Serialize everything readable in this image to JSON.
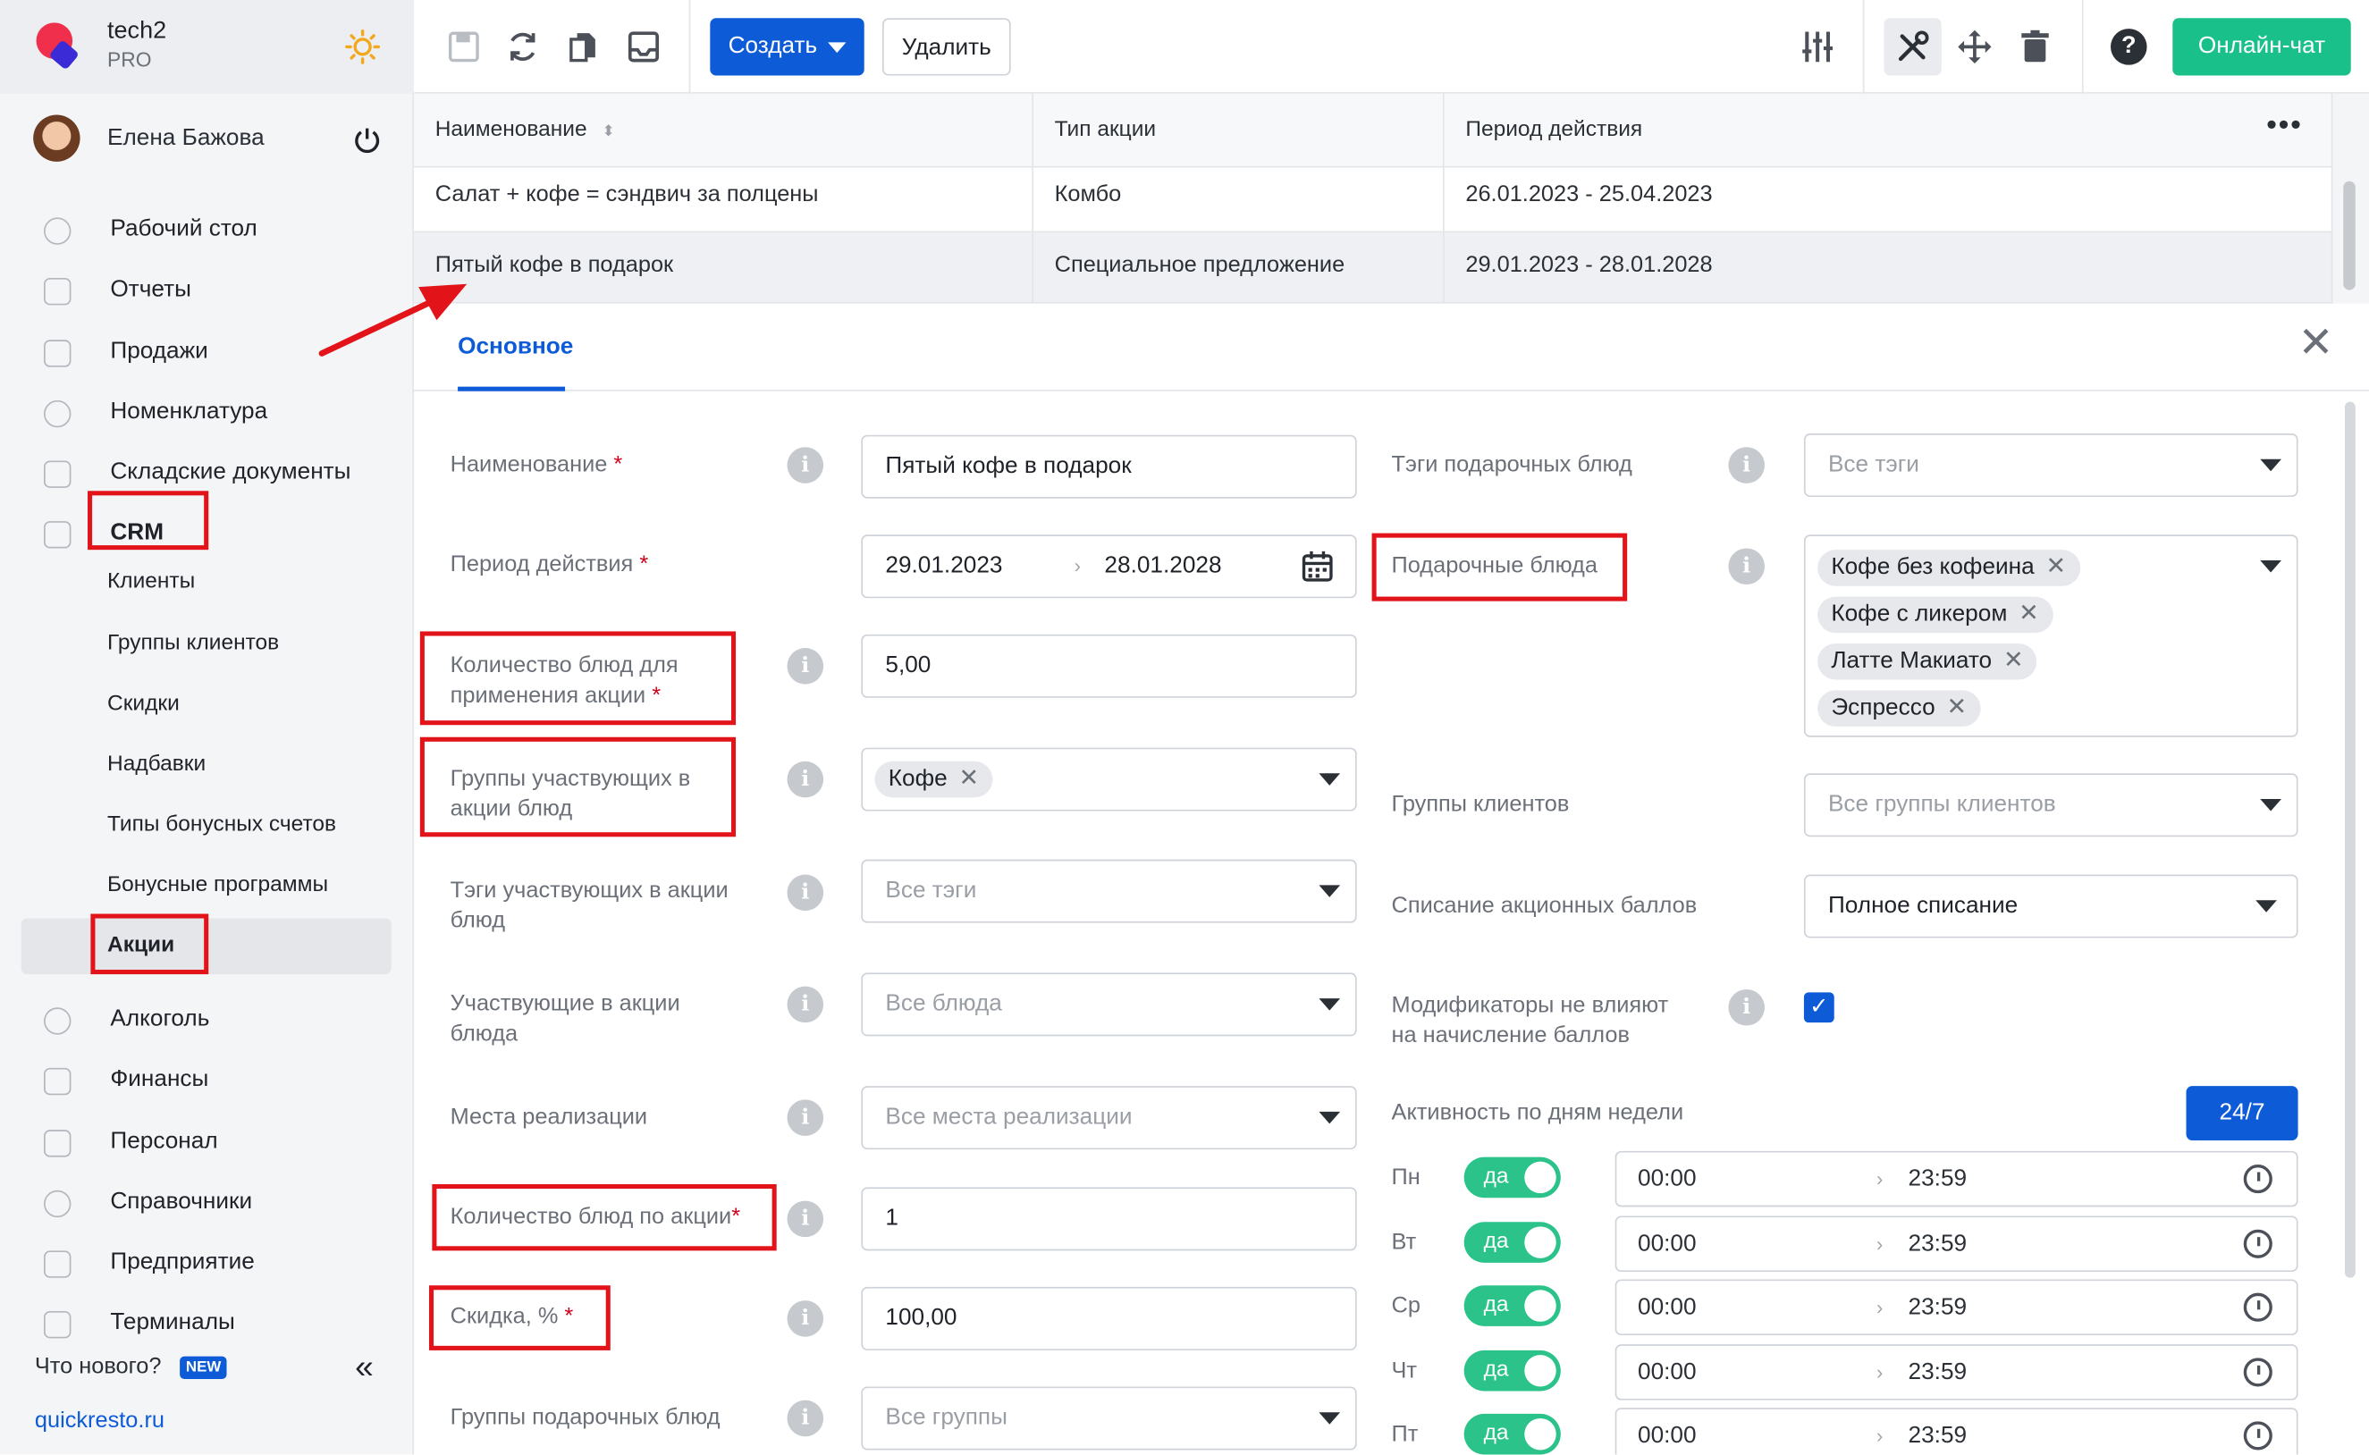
{
  "brand": {
    "name": "tech2",
    "plan": "PRO"
  },
  "user": {
    "name": "Елена Бажова"
  },
  "sidebar": {
    "items": [
      {
        "label": "Рабочий стол",
        "icon": "dashboard-icon"
      },
      {
        "label": "Отчеты",
        "icon": "chart-icon"
      },
      {
        "label": "Продажи",
        "icon": "basket-icon"
      },
      {
        "label": "Номенклатура",
        "icon": "tag-icon"
      },
      {
        "label": "Складские документы",
        "icon": "archive-icon"
      },
      {
        "label": "CRM",
        "icon": "hierarchy-icon"
      },
      {
        "label": "Алкоголь",
        "icon": "cocktail-icon"
      },
      {
        "label": "Финансы",
        "icon": "wallet-icon"
      },
      {
        "label": "Персонал",
        "icon": "people-icon"
      },
      {
        "label": "Справочники",
        "icon": "book-icon"
      },
      {
        "label": "Предприятие",
        "icon": "store-icon"
      },
      {
        "label": "Терминалы",
        "icon": "qr-icon"
      }
    ],
    "crm_sub": [
      "Клиенты",
      "Группы клиентов",
      "Скидки",
      "Надбавки",
      "Типы бонусных счетов",
      "Бонусные программы",
      "Акции"
    ],
    "whats_new": "Что нового?",
    "new_badge": "NEW",
    "site": "quickresto.ru"
  },
  "toolbar": {
    "create": "Создать",
    "delete": "Удалить",
    "chat": "Онлайн-чат"
  },
  "table": {
    "columns": [
      "Наименование",
      "Тип акции",
      "Период действия"
    ],
    "rows": [
      [
        "Салат + кофе = сэндвич за полцены",
        "Комбо",
        "26.01.2023 - 25.04.2023"
      ],
      [
        "Пятый кофе в подарок",
        "Специальное предложение",
        "29.01.2023 - 28.01.2028"
      ]
    ]
  },
  "form": {
    "tab": "Основное",
    "left": {
      "name_label": "Наименование",
      "name_value": "Пятый кофе в подарок",
      "period_label": "Период действия",
      "period_from": "29.01.2023",
      "period_to": "28.01.2028",
      "qty_apply_label_1": "Количество блюд для",
      "qty_apply_label_2": "применения акции",
      "qty_apply_value": "5,00",
      "groups_label_1": "Группы участвующих в",
      "groups_label_2": "акции блюд",
      "groups_chip": "Кофе",
      "tags_label_1": "Тэги участвующих в акции",
      "tags_label_2": "блюд",
      "tags_placeholder": "Все тэги",
      "dishes_label_1": "Участвующие в акции",
      "dishes_label_2": "блюда",
      "dishes_placeholder": "Все блюда",
      "places_label": "Места реализации",
      "places_placeholder": "Все места реализации",
      "qty_promo_label": "Количество блюд по акции",
      "qty_promo_value": "1",
      "discount_label": "Скидка, %",
      "discount_value": "100,00",
      "gift_groups_label": "Группы подарочных блюд",
      "gift_groups_placeholder": "Все группы"
    },
    "right": {
      "gift_tags_label": "Тэги подарочных блюд",
      "gift_tags_placeholder": "Все тэги",
      "gift_dishes_label": "Подарочные блюда",
      "gift_dishes": [
        "Кофе без кофеина",
        "Кофе с ликером",
        "Латте Макиато",
        "Эспрессо"
      ],
      "client_groups_label": "Группы клиентов",
      "client_groups_placeholder": "Все группы клиентов",
      "writeoff_label": "Списание акционных баллов",
      "writeoff_value": "Полное списание",
      "modifiers_label_1": "Модификаторы не влияют",
      "modifiers_label_2": "на начисление баллов",
      "modifiers_checked": true,
      "activity_label": "Активность по дням недели",
      "activity_btn": "24/7",
      "days": [
        {
          "day": "Пн",
          "toggle": "да",
          "from": "00:00",
          "to": "23:59"
        },
        {
          "day": "Вт",
          "toggle": "да",
          "from": "00:00",
          "to": "23:59"
        },
        {
          "day": "Ср",
          "toggle": "да",
          "from": "00:00",
          "to": "23:59"
        },
        {
          "day": "Чт",
          "toggle": "да",
          "from": "00:00",
          "to": "23:59"
        },
        {
          "day": "Пт",
          "toggle": "да",
          "from": "00:00",
          "to": "23:59"
        }
      ]
    }
  },
  "colors": {
    "accent": "#0d5bd7",
    "chat": "#19c08a",
    "annotation": "#e2141a",
    "toggle": "#2cc38a"
  }
}
